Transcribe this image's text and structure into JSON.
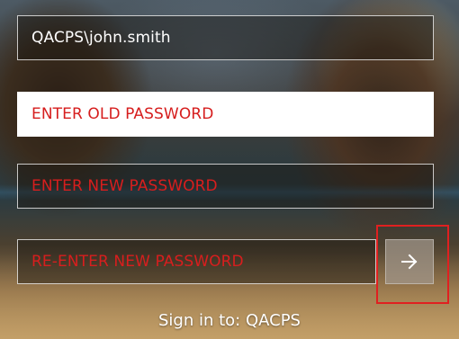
{
  "login": {
    "username": "QACPS\\john.smith",
    "old_password_placeholder": "ENTER OLD PASSWORD",
    "new_password_placeholder": "ENTER NEW PASSWORD",
    "reenter_password_placeholder": "RE-ENTER NEW PASSWORD",
    "submit_icon": "arrow-right-icon",
    "sign_in_text": "Sign in to: QACPS"
  },
  "colors": {
    "placeholder_red": "#d81e1e",
    "highlight_red": "#e02020",
    "field_border": "#ffffff"
  }
}
